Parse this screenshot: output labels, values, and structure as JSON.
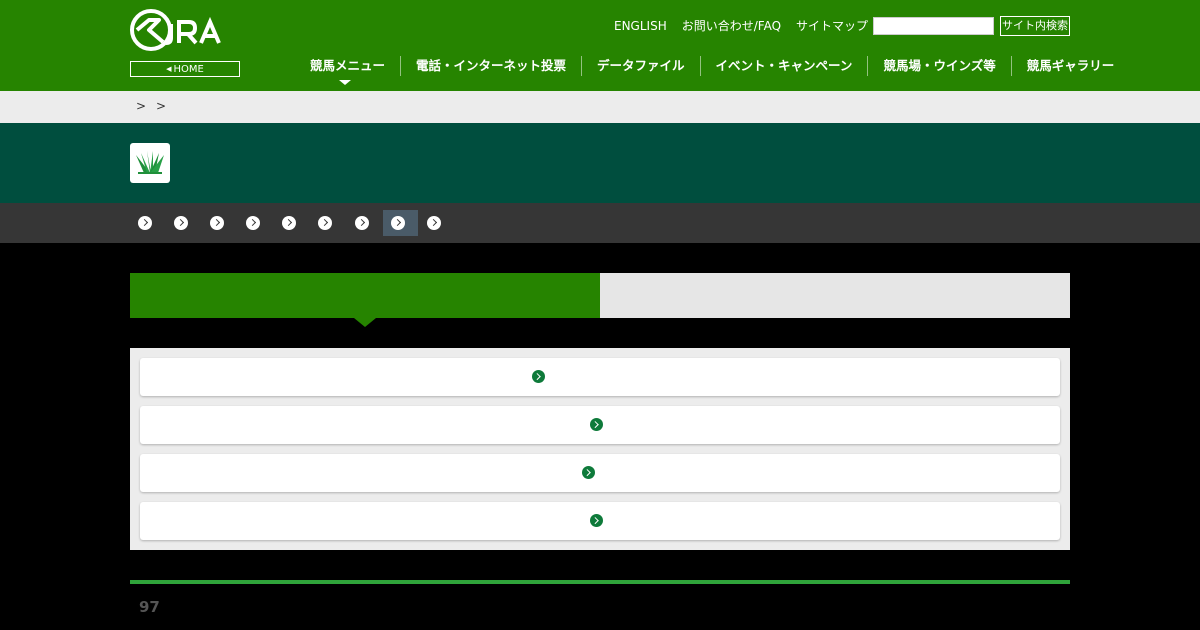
{
  "header": {
    "home_label": "HOME",
    "util_links": [
      "ENGLISH",
      "お問い合わせ/FAQ",
      "サイトマップ"
    ],
    "search_placeholder": "",
    "search_button": "サイト内検索",
    "nav": [
      "競馬メニュー",
      "電話・インターネット投票",
      "データファイル",
      "イベント・キャンペーン",
      "競馬場・ウインズ等",
      "競馬ギャラリー"
    ],
    "brand_color": "#268400"
  },
  "breadcrumb": {
    "separators": [
      ">",
      ">"
    ]
  },
  "title_band": {
    "icon": "turf-grass-icon",
    "color": "#004e3e"
  },
  "sub_nav": {
    "count": 9,
    "active_index": 7
  },
  "tabs": {
    "active": "left"
  },
  "list": {
    "count": 4
  },
  "footer": {
    "number": "97",
    "accent": "#2fa33a"
  }
}
